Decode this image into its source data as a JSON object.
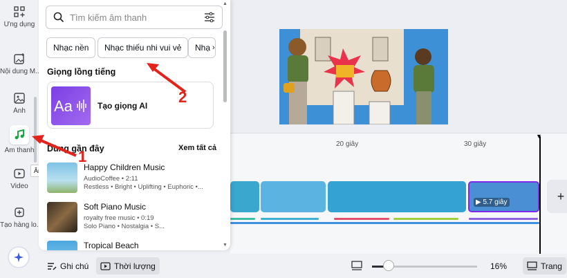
{
  "sidebar": {
    "items": [
      {
        "label": "Ứng dụng",
        "icon": "apps-icon"
      },
      {
        "label": "Nội dung M...",
        "icon": "magic-media-icon"
      },
      {
        "label": "Ảnh",
        "icon": "photo-icon"
      },
      {
        "label": "Âm thanh",
        "icon": "music-note-icon",
        "active": true
      },
      {
        "label": "Video",
        "icon": "video-icon"
      },
      {
        "label": "Tạo hàng lo...",
        "icon": "bulk-create-icon"
      }
    ],
    "tooltip": "Âm thanh"
  },
  "panel": {
    "search_placeholder": "Tìm kiếm âm thanh",
    "chips": [
      "Nhạc nền",
      "Nhạc thiếu nhi vui vẻ",
      "Nhạ"
    ],
    "voice_section_title": "Giọng lồng tiếng",
    "ai_voice_label": "Tạo giọng AI",
    "recent_section_title": "Dùng gần đây",
    "see_all": "Xem tất cả",
    "tracks": [
      {
        "title": "Happy Children Music",
        "sub": "AudioCoffee • 2:11",
        "tags": "Restless • Bright • Uplifting • Euphoric •..."
      },
      {
        "title": "Soft Piano Music",
        "sub": "royalty free music • 0:19",
        "tags": "Solo Piano • Nostalgia • S..."
      },
      {
        "title": "Tropical Beach",
        "sub": "",
        "tags": ""
      }
    ]
  },
  "timeline": {
    "ticks": [
      "20 giây",
      "30 giây"
    ],
    "selected_clip_duration": "5.7 giây"
  },
  "bottom_bar": {
    "notes_label": "Ghi chú",
    "duration_label": "Thời lượng",
    "zoom": "16%",
    "pages_label": "Trang",
    "zoom_fraction": 0.16
  },
  "annotations": [
    "2",
    "1"
  ],
  "colors": {
    "accent": "#7d2ae8",
    "annotation": "#e3241d",
    "music_icon": "#1ea446"
  }
}
